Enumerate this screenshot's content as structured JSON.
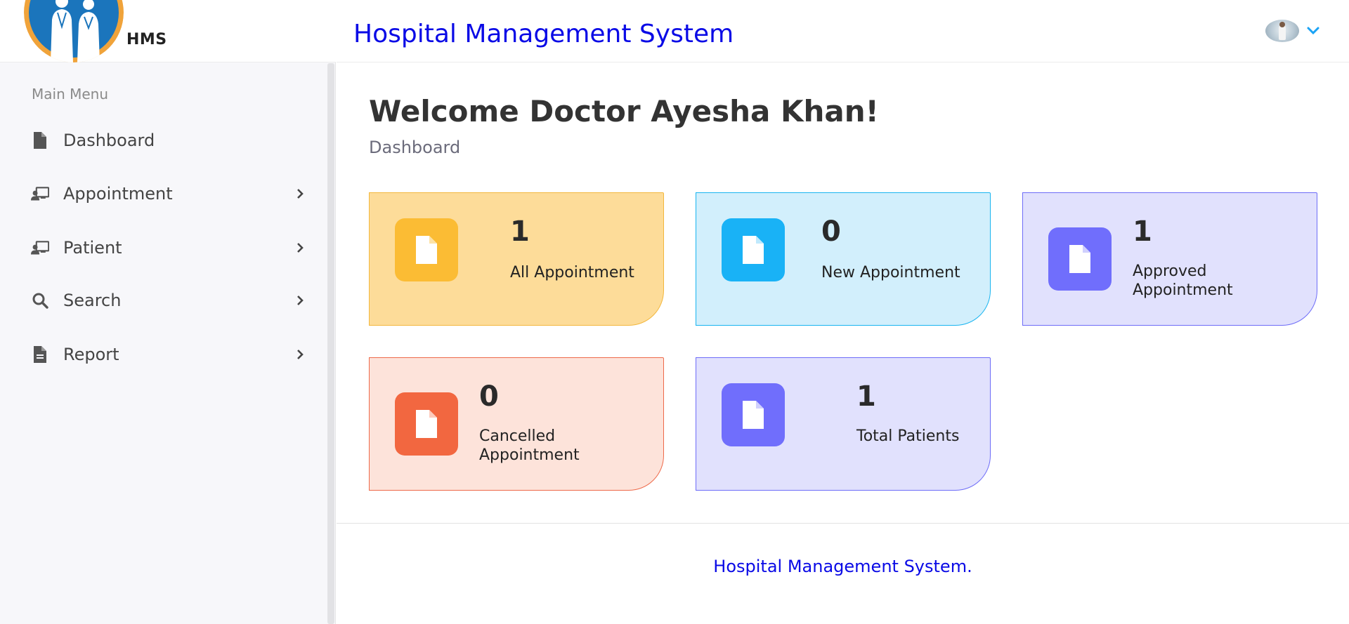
{
  "brand": {
    "name": "HMS"
  },
  "sidebar": {
    "menu_title": "Main Menu",
    "items": [
      {
        "label": "Dashboard",
        "icon": "file-icon",
        "has_submenu": false
      },
      {
        "label": "Appointment",
        "icon": "user-board-icon",
        "has_submenu": true
      },
      {
        "label": "Patient",
        "icon": "user-board-icon",
        "has_submenu": true
      },
      {
        "label": "Search",
        "icon": "search-icon",
        "has_submenu": true
      },
      {
        "label": "Report",
        "icon": "file-icon",
        "has_submenu": true
      }
    ]
  },
  "header": {
    "title": "Hospital Management System",
    "user_menu_icon": "chevron-down-icon"
  },
  "main": {
    "welcome": "Welcome Doctor Ayesha Khan!",
    "breadcrumb": "Dashboard",
    "cards": [
      {
        "count": "1",
        "label": "All Appointment",
        "icon": "file-icon",
        "color": "#fbbc34"
      },
      {
        "count": "0",
        "label": "New Appointment",
        "icon": "file-icon",
        "color": "#19b2f6"
      },
      {
        "count": "1",
        "label_line1": "Approved",
        "label_line2": "Appointment",
        "icon": "file-icon",
        "color": "#706efc"
      },
      {
        "count": "0",
        "label_line1": "Cancelled",
        "label_line2": "Appointment",
        "icon": "file-icon",
        "color": "#f26740"
      },
      {
        "count": "1",
        "label": "Total Patients",
        "icon": "file-icon",
        "color": "#706efc"
      }
    ]
  },
  "footer": {
    "text": "Hospital Management System."
  },
  "colors": {
    "title_blue": "#0a0ae6",
    "sidebar_bg": "#f7f7fa",
    "chevron_blue": "#1aa3f5"
  }
}
